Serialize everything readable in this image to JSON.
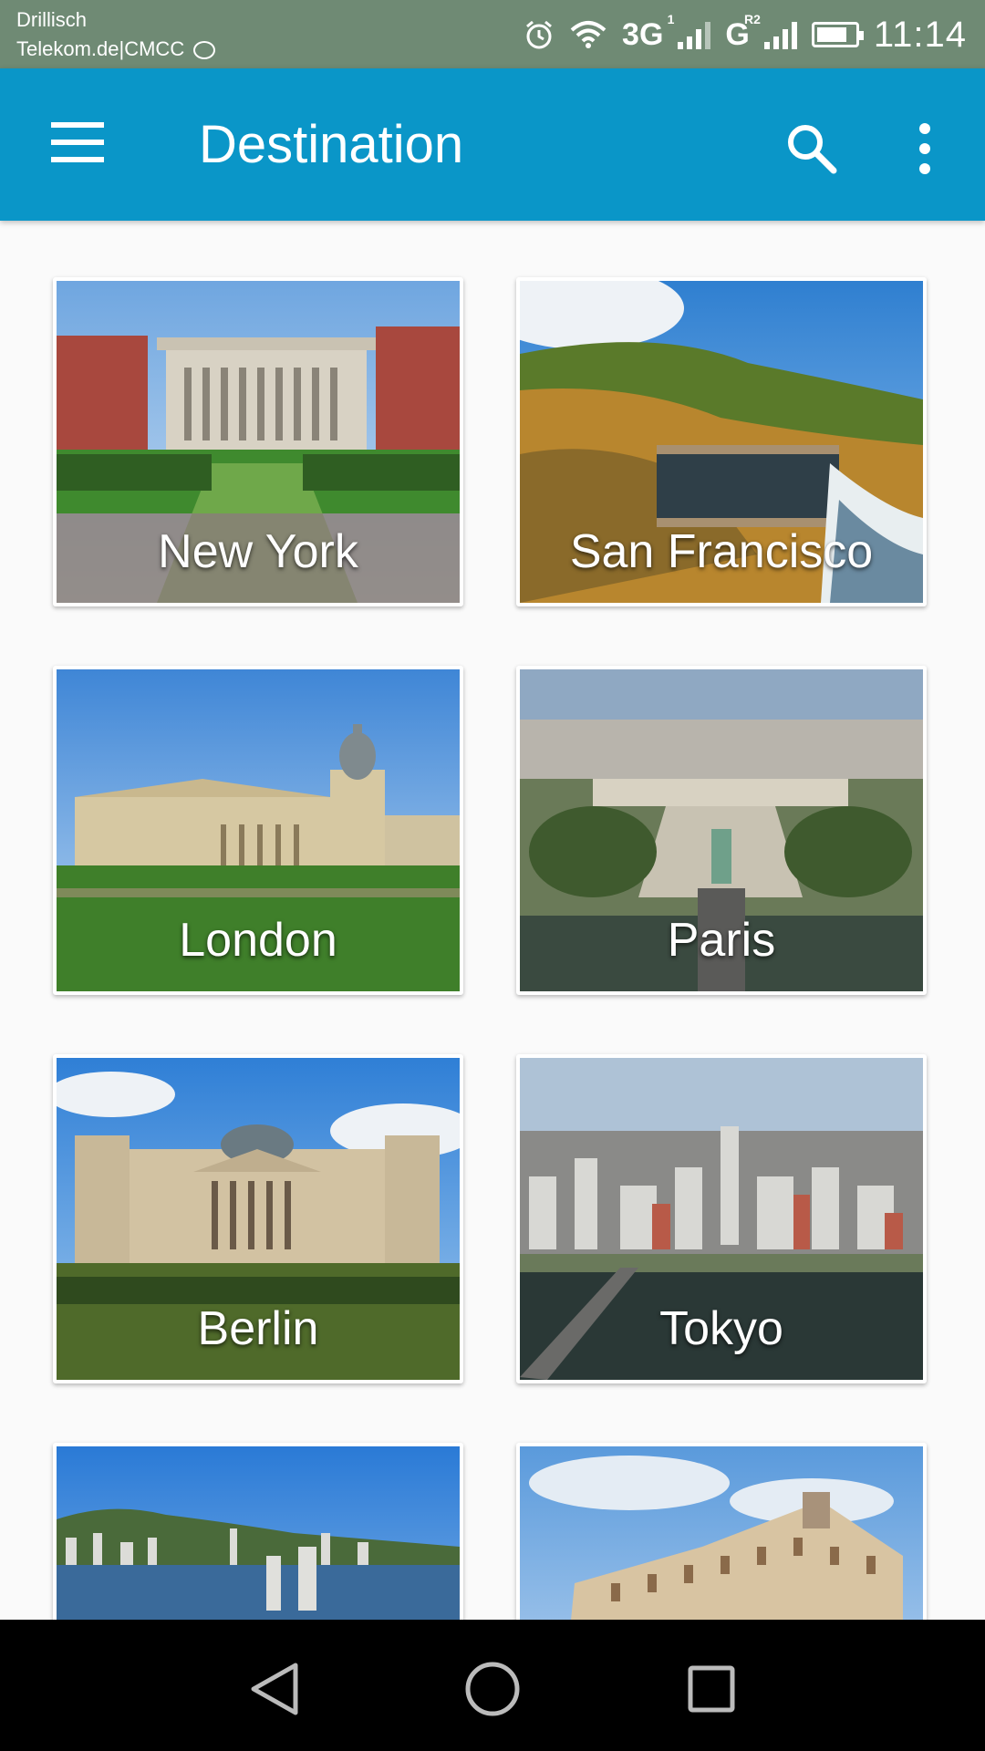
{
  "status_bar": {
    "carrier_line1": "Drillisch",
    "carrier_line2": "Telekom.de|CMCC",
    "net1": "3G",
    "net1_sup": "1",
    "net2": "G",
    "net2_sup": "R2",
    "time": "11:14",
    "icons": [
      "message-icon",
      "alarm-icon",
      "wifi-icon",
      "signal-icon",
      "battery-icon"
    ]
  },
  "app_bar": {
    "title": "Destination",
    "color": "#0a96c8",
    "icons": [
      "menu-icon",
      "search-icon",
      "more-vert-icon"
    ]
  },
  "destinations": [
    {
      "name": "New York"
    },
    {
      "name": "San Francisco"
    },
    {
      "name": "London"
    },
    {
      "name": "Paris"
    },
    {
      "name": "Berlin"
    },
    {
      "name": "Tokyo"
    },
    {
      "name": ""
    },
    {
      "name": ""
    }
  ],
  "nav_bar": {
    "icons": [
      "back-icon",
      "home-icon",
      "recents-icon"
    ]
  }
}
